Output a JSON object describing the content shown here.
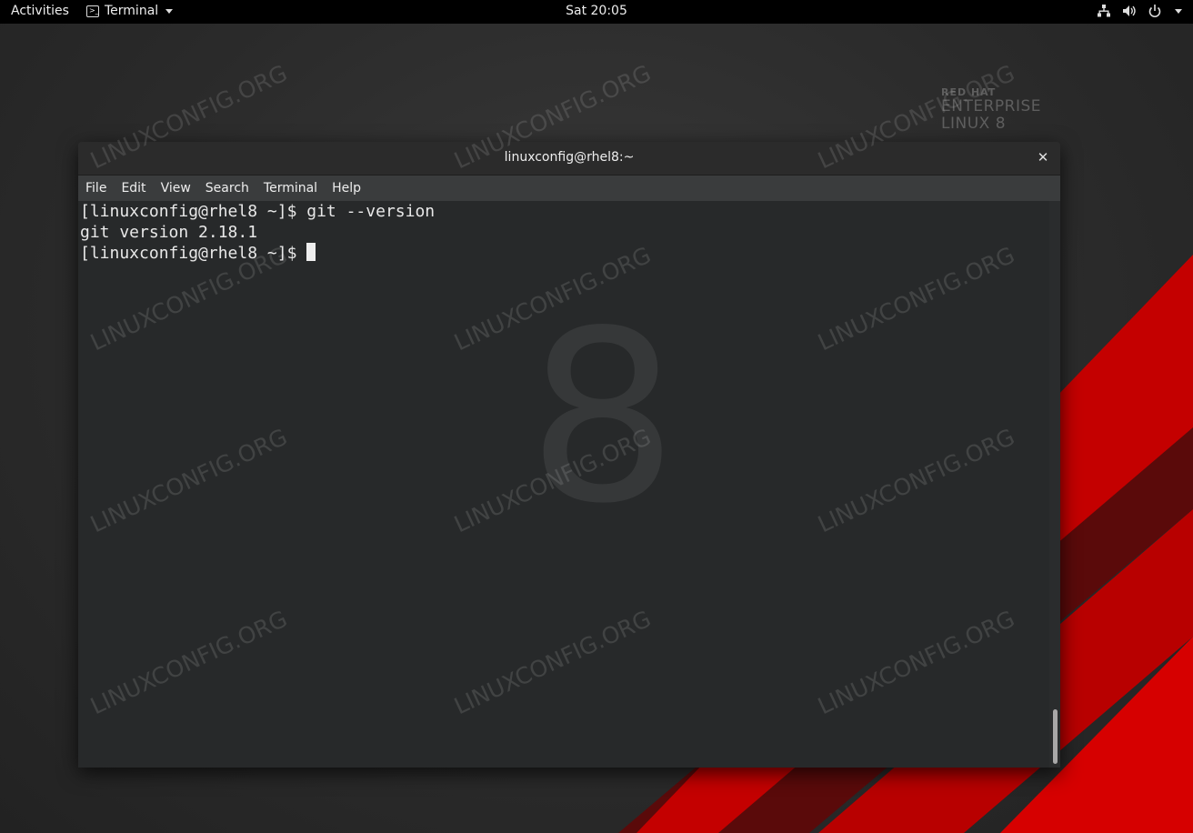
{
  "topbar": {
    "activities": "Activities",
    "app_name": "Terminal",
    "clock": "Sat 20:05",
    "icons": [
      "network-icon",
      "volume-icon",
      "power-icon",
      "chevron-down-icon"
    ]
  },
  "wallpaper": {
    "brand_line1": "RED HAT",
    "brand_line2": "ENTERPRISE",
    "brand_line3": "LINUX 8",
    "big_digit": "8",
    "watermark": "LINUXCONFIG.ORG",
    "accent_color": "#cc0000"
  },
  "window": {
    "title": "linuxconfig@rhel8:~",
    "close_glyph": "✕",
    "menu": {
      "file": "File",
      "edit": "Edit",
      "view": "View",
      "search": "Search",
      "terminal": "Terminal",
      "help": "Help"
    },
    "terminal": {
      "line1": "[linuxconfig@rhel8 ~]$ git --version",
      "line2": "git version 2.18.1",
      "line3": "[linuxconfig@rhel8 ~]$ "
    }
  }
}
